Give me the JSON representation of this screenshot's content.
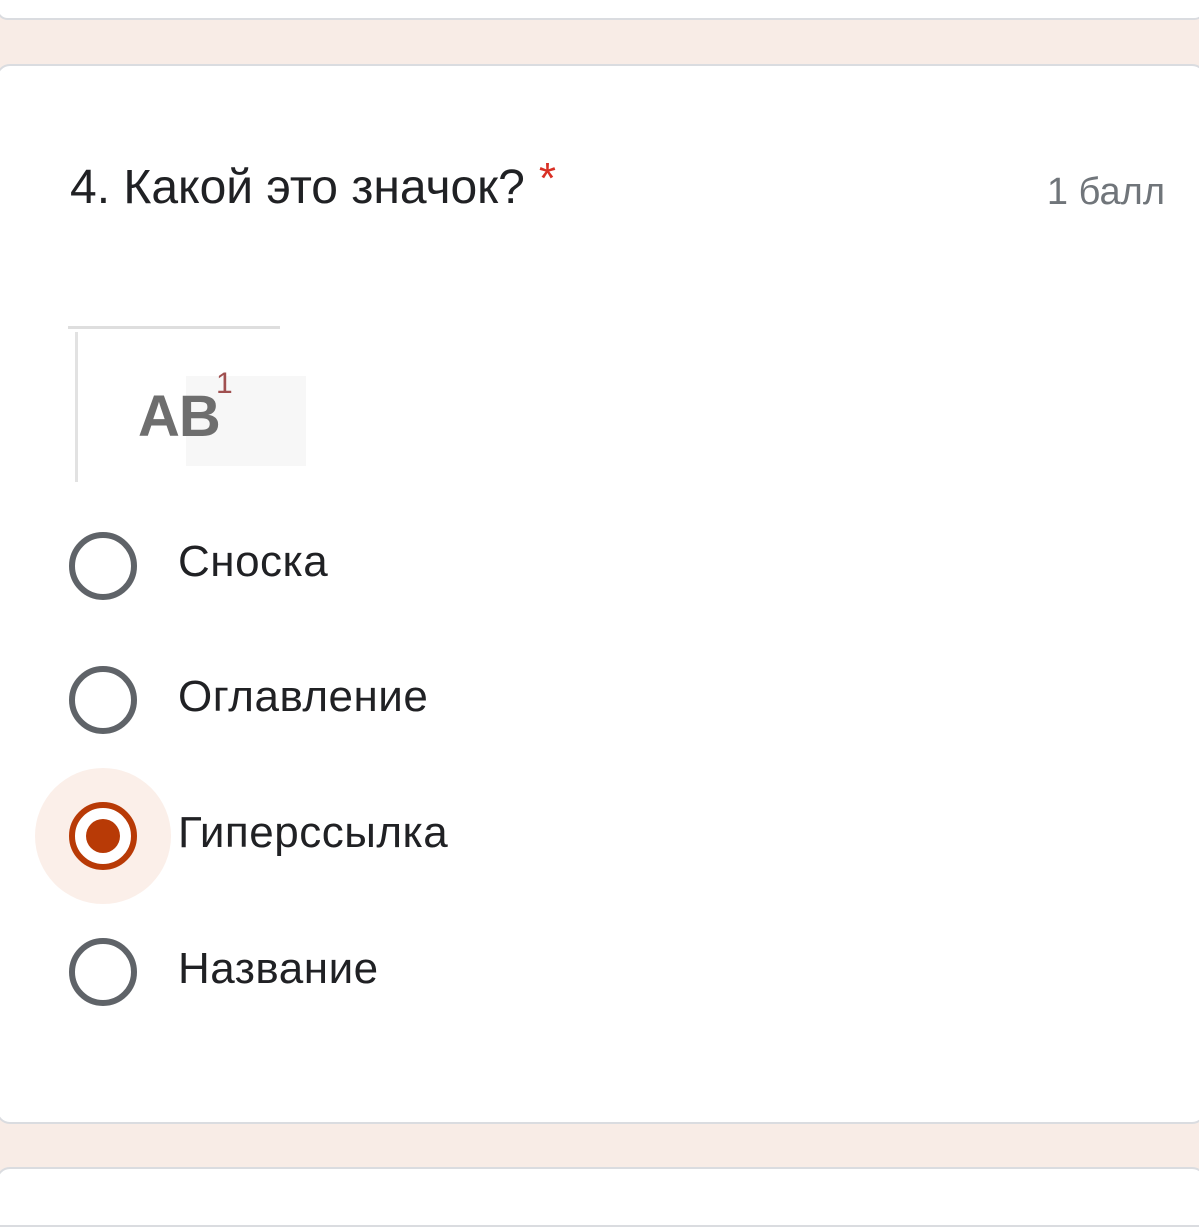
{
  "question": {
    "number_title": "4. Какой это значок?",
    "required_mark": "*",
    "points": "1 балл",
    "image": {
      "text": "AB",
      "superscript": "1"
    },
    "options": [
      {
        "label": "Сноска",
        "selected": false
      },
      {
        "label": "Оглавление",
        "selected": false
      },
      {
        "label": "Гиперссылка",
        "selected": true
      },
      {
        "label": "Название",
        "selected": false
      }
    ]
  },
  "colors": {
    "accent": "#b83a06",
    "background": "#f8ece6",
    "required": "#d93025"
  }
}
